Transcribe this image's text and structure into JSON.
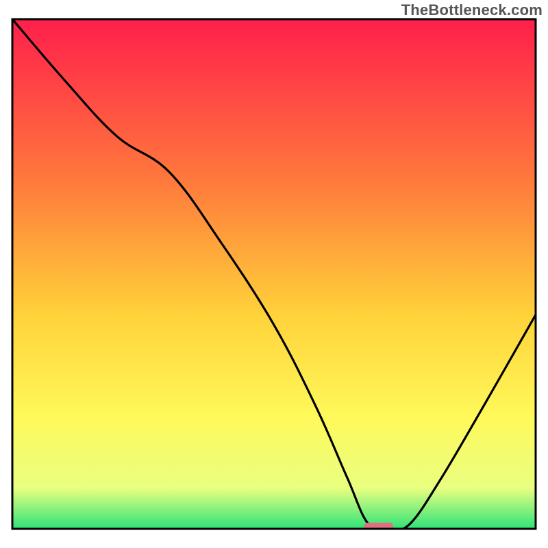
{
  "watermark": "TheBottleneck.com",
  "colors": {
    "top": "#ff1f4b",
    "mid1": "#ff7a3c",
    "mid2": "#ffd23a",
    "mid3": "#fff95a",
    "mid4": "#e9ff80",
    "bottom": "#2fe379",
    "frame": "#000000",
    "curve": "#000000",
    "marker": "#e07080"
  },
  "chart_data": {
    "type": "line",
    "title": "",
    "xlabel": "",
    "ylabel": "",
    "xlim": [
      0,
      100
    ],
    "ylim": [
      0,
      100
    ],
    "x": [
      0,
      10,
      20,
      30,
      40,
      50,
      58,
      64,
      68,
      72,
      76,
      82,
      90,
      100
    ],
    "values": [
      100,
      88,
      77,
      70,
      56,
      40,
      24,
      10,
      1,
      0,
      1,
      10,
      24,
      42
    ],
    "marker": {
      "x_center": 70,
      "x_half_width": 2.8,
      "y": 0
    },
    "annotations": []
  }
}
